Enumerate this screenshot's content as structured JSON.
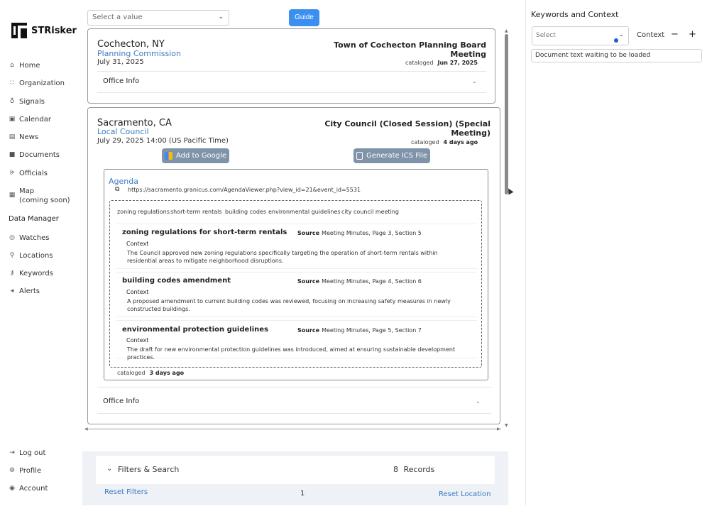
{
  "app": {
    "name": "STRisker"
  },
  "sidebar": {
    "items": [
      {
        "label": "Home",
        "icon": "home-icon",
        "glyph": "⌂"
      },
      {
        "label": "Organization",
        "icon": "grid-icon",
        "glyph": "∷"
      },
      {
        "label": "Signals",
        "icon": "bulb-icon",
        "glyph": "♁"
      },
      {
        "label": "Calendar",
        "icon": "calendar-icon",
        "glyph": "▣"
      },
      {
        "label": "News",
        "icon": "news-icon",
        "glyph": "▤"
      },
      {
        "label": "Documents",
        "icon": "folder-icon",
        "glyph": "■"
      },
      {
        "label": "Officials",
        "icon": "people-icon",
        "glyph": "ꔭ"
      },
      {
        "label": "Map\n(coming soon)",
        "label_1": "Map",
        "label_2": "(coming soon)",
        "icon": "map-icon",
        "glyph": "▦"
      }
    ],
    "section_header": "Data Manager",
    "data_items": [
      {
        "label": "Watches",
        "icon": "eye-icon",
        "glyph": "◎"
      },
      {
        "label": "Locations",
        "icon": "pin-icon",
        "glyph": "⚲"
      },
      {
        "label": "Keywords",
        "icon": "key-icon",
        "glyph": "⚷"
      },
      {
        "label": "Alerts",
        "icon": "megaphone-icon",
        "glyph": "◂"
      }
    ],
    "bottom_items": [
      {
        "label": "Log out",
        "icon": "logout-icon",
        "glyph": "⇥"
      },
      {
        "label": "Profile",
        "icon": "gear-icon",
        "glyph": "⚙"
      },
      {
        "label": "Account",
        "icon": "user-circle-icon",
        "glyph": "◉"
      }
    ]
  },
  "toolbar": {
    "select_placeholder": "Select a value",
    "guide_label": "Guide"
  },
  "meetings": [
    {
      "location": "Cochecton, NY",
      "organization": "Planning Commission",
      "date": "July 31, 2025",
      "title": "Town of Cochecton Planning Board Meeting",
      "cataloged_label": "cataloged",
      "cataloged_value": "Jun 27, 2025",
      "office_info": "Office Info"
    },
    {
      "location": "Sacramento, CA",
      "organization": "Local Council",
      "date": "July 29, 2025 14:00 (US Pacific Time)",
      "title": "City Council (Closed Session) (Special Meeting)",
      "cataloged_label": "cataloged",
      "cataloged_value": "4 days ago",
      "add_google": "Add to Google",
      "generate_ics": "Generate ICS File",
      "agenda": {
        "title": "Agenda",
        "url": "https://sacramento.granicus.com/AgendaViewer.php?view_id=21&event_id=5531",
        "tags": [
          "zoning regulations",
          "short-term rentals",
          "building codes",
          "environmental guidelines",
          "city council meeting"
        ],
        "entries": [
          {
            "title": "zoning regulations for short-term rentals",
            "source_label": "Source",
            "source": "Meeting Minutes, Page 3, Section 5",
            "context_label": "Context",
            "text": "The Council approved new zoning regulations specifically targeting the operation of short-term rentals within residential areas to mitigate neighborhood disruptions."
          },
          {
            "title": "building codes amendment",
            "source_label": "Source",
            "source": "Meeting Minutes, Page 4, Section 6",
            "context_label": "Context",
            "text": "A proposed amendment to current building codes was reviewed, focusing on increasing safety measures in newly constructed buildings."
          },
          {
            "title": "environmental protection guidelines",
            "source_label": "Source",
            "source": "Meeting Minutes, Page 5, Section 7",
            "context_label": "Context",
            "text": "The draft for new environmental protection guidelines was introduced, aimed at ensuring sustainable development practices."
          }
        ],
        "cataloged_label": "cataloged",
        "cataloged_value": "3 days ago"
      },
      "office_info": "Office Info"
    }
  ],
  "footer": {
    "filters_label": "Filters & Search",
    "records_count": "8",
    "records_label": "Records",
    "reset_filters": "Reset Filters",
    "page": "1",
    "reset_location": "Reset Location"
  },
  "right_panel": {
    "title": "Keywords and Context",
    "select_placeholder": "Select",
    "context_label": "Context",
    "minus": "−",
    "plus": "+",
    "document_text": "Document text waiting to be loaded"
  },
  "colors": {
    "accent": "#3b8ff0",
    "link": "#3b7cc4",
    "button_muted": "#7f93a9",
    "footer_bg": "#eef1f6"
  }
}
